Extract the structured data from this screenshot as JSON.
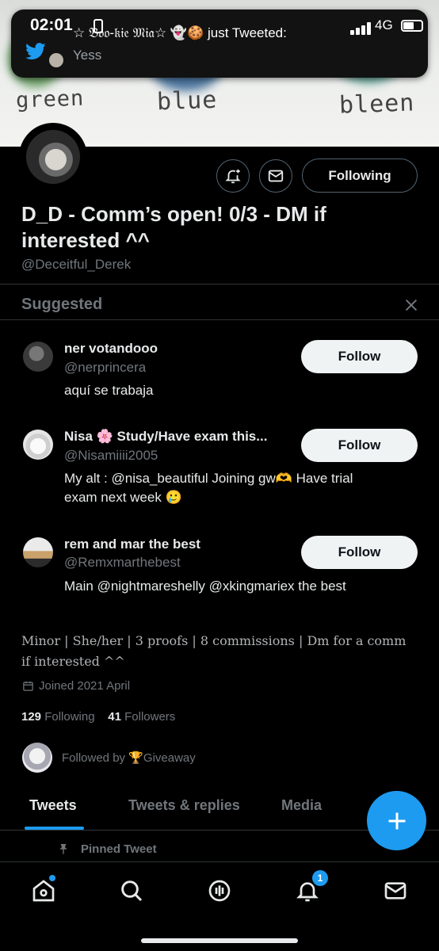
{
  "status_bar": {
    "time": "02:01",
    "network": "4G"
  },
  "notification": {
    "title": "☆ 𝔅𝔬𝔬-𝔨𝔦𝔢 𝔐𝔦𝔞☆ 👻🍪 just Tweeted:",
    "body": "Yess"
  },
  "banner": {
    "words": [
      "green",
      "blue",
      "bleen"
    ]
  },
  "profile": {
    "following_label": "Following",
    "display_name": "D_D - Comm’s open! 0/3 - DM if interested ^^",
    "handle": "@Deceitful_Derek",
    "bio": "Minor | She/her | 3 proofs | 8 commissions | Dm for a comm if interested ^^",
    "joined": "Joined 2021 April",
    "following_count": "129",
    "following_label_text": "Following",
    "followers_count": "41",
    "followers_label_text": "Followers",
    "followed_by_prefix": "Followed by",
    "followed_by_name": "🏆Giveaway"
  },
  "suggested": {
    "title": "Suggested",
    "follow_label": "Follow",
    "items": [
      {
        "name": "ner votandooo",
        "handle": "@nerprincera",
        "bio": "aquí se trabaja"
      },
      {
        "name": "Nisa 🌸 Study/Have exam this...",
        "handle": "@Nisamiiii2005",
        "bio": "My alt : @nisa_beautiful Joining gw🫶 Have trial exam next week 🥲"
      },
      {
        "name": "rem and mar the best",
        "handle": "@Remxmarthebest",
        "bio": "Main @nightmareshelly @xkingmariex the best"
      }
    ]
  },
  "tabs": [
    "Tweets",
    "Tweets & replies",
    "Media"
  ],
  "pinned_label": "Pinned Tweet",
  "bottom_nav": {
    "notifications_badge": "1"
  },
  "colors": {
    "accent": "#1d9bf0",
    "background": "#000000",
    "muted": "#71767b"
  }
}
